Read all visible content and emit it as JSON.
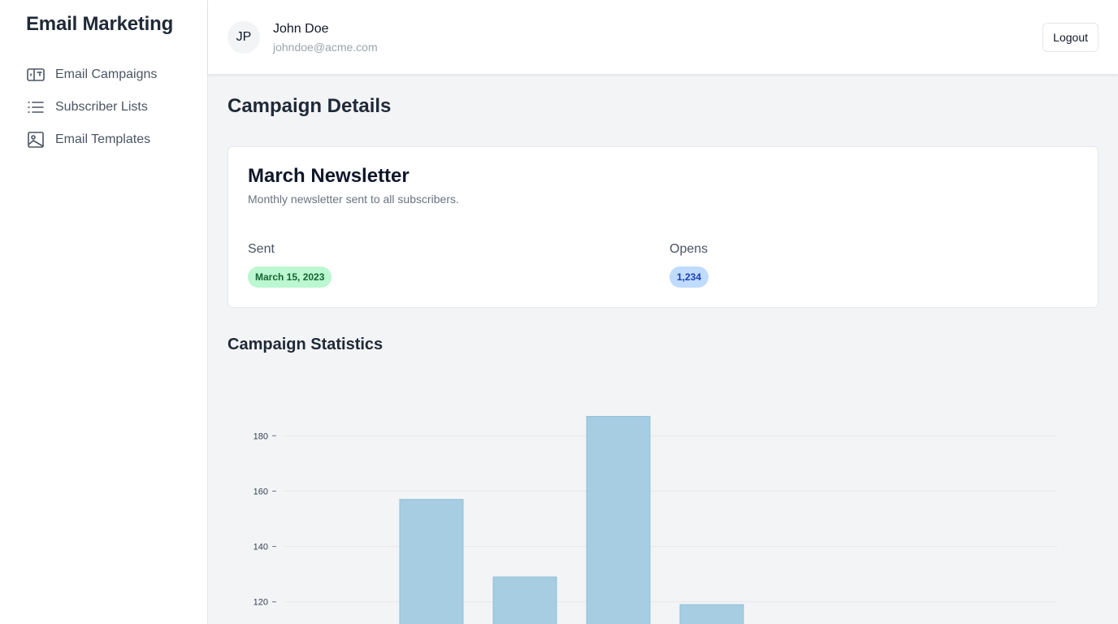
{
  "app": {
    "title": "Email Marketing"
  },
  "sidebar": {
    "items": [
      {
        "label": "Email Campaigns",
        "icon": "campaign-icon"
      },
      {
        "label": "Subscriber Lists",
        "icon": "list-icon"
      },
      {
        "label": "Email Templates",
        "icon": "image-icon"
      }
    ]
  },
  "header": {
    "avatar_initials": "JP",
    "user_name": "John Doe",
    "user_email": "johndoe@acme.com",
    "logout_label": "Logout"
  },
  "main": {
    "page_title": "Campaign Details",
    "campaign": {
      "name": "March Newsletter",
      "description": "Monthly newsletter sent to all subscribers.",
      "sent_label": "Sent",
      "sent_value": "March 15, 2023",
      "opens_label": "Opens",
      "opens_value": "1,234"
    },
    "stats_title": "Campaign Statistics"
  },
  "colors": {
    "bar": "#a6cde1",
    "sent_badge_bg": "#bbf7d0",
    "opens_badge_bg": "#bfdbfe"
  },
  "chart_data": {
    "type": "bar",
    "categories": [
      "",
      "",
      "",
      "",
      "",
      "",
      "",
      ""
    ],
    "values": [
      null,
      157,
      129,
      187,
      119,
      null,
      null,
      null
    ],
    "yticks": [
      120,
      140,
      160,
      180
    ],
    "ylim": [
      112,
      193
    ],
    "grid": true,
    "title": "",
    "xlabel": "",
    "ylabel": ""
  }
}
